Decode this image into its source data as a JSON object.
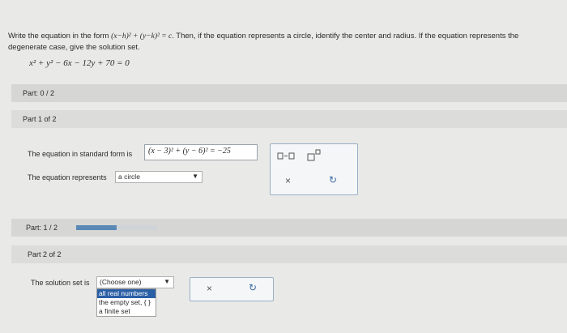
{
  "question": {
    "prompt_pre": "Write the equation in the form",
    "form": "(x−h)² + (y−k)² = c",
    "prompt_post": ". Then, if the equation represents a circle, identify the center and radius. If the equation represents the degenerate case, give the solution set.",
    "equation": "x² + y² − 6x − 12y + 70 = 0"
  },
  "part_summary_1": {
    "label": "Part: 0 / 2"
  },
  "part1": {
    "header": "Part 1 of 2",
    "standard_form_label": "The equation in standard form is",
    "standard_form_value": "(x − 3)² + (y − 6)² = −25",
    "represents_label": "The equation represents",
    "represents_value": "a circle"
  },
  "toolbar1": {
    "fraction_icon": "fraction-icon",
    "exponent_icon": "exponent-icon",
    "clear_label": "×",
    "redo_label": "↻"
  },
  "part_summary_2": {
    "label": "Part: 1 / 2",
    "progress": 0.5
  },
  "part2": {
    "header": "Part 2 of 2",
    "solution_label": "The solution set is",
    "select_value": "(Choose one)",
    "options": [
      "all real numbers",
      "the empty set, { }",
      "a finite set"
    ],
    "selected_index": 0
  },
  "toolbar2": {
    "clear_label": "×",
    "redo_label": "↻"
  },
  "colors": {
    "progress": "#5b89b5",
    "selected": "#2b5fa5",
    "accent": "#3f6ea5"
  }
}
